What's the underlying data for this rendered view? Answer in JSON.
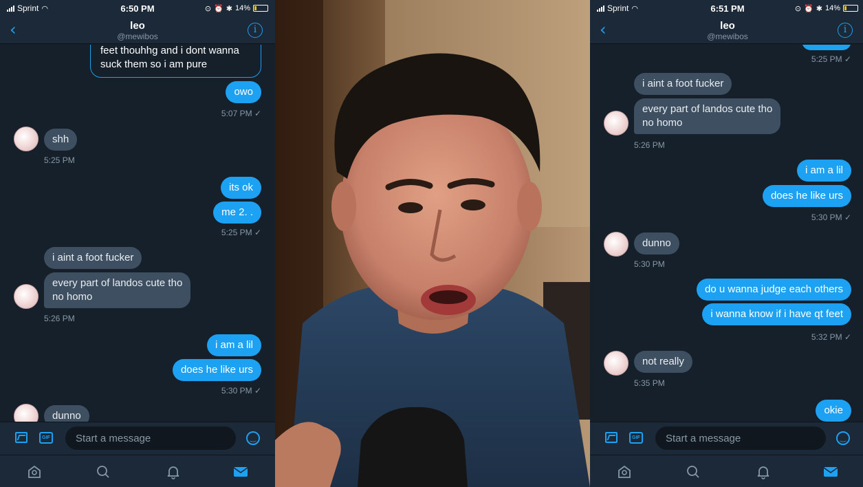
{
  "colors": {
    "accent": "#1da1f2",
    "background": "#15202b",
    "bar": "#1c2938",
    "incoming_bubble": "#3d4f61",
    "muted_text": "#8899a6",
    "battery_fill": "#f5c400"
  },
  "left": {
    "status": {
      "carrier": "Sprint",
      "time": "6:50 PM",
      "battery": "14%"
    },
    "header": {
      "name": "leo",
      "handle": "@mewibos"
    },
    "messages": {
      "quoted_line1": "feet thouhhg and i dont wanna",
      "quoted_line2": "suck them so i am pure",
      "owo": "owo",
      "ts_507": "5:07 PM ✓",
      "shh": "shh",
      "ts_525_in": "5:25 PM",
      "its_ok": "its ok",
      "me2": "me 2. .",
      "ts_525_out": "5:25 PM ✓",
      "foot": "i aint a foot fucker",
      "landos_line1": "every part of landos cute tho",
      "landos_line2": "no homo",
      "ts_526": "5:26 PM",
      "lil": "i am a lil",
      "urs": "does he like urs",
      "ts_530_out": "5:30 PM ✓",
      "dunno": "dunno"
    },
    "composer": {
      "placeholder": "Start a message",
      "gif_label": "GIF"
    }
  },
  "right": {
    "status": {
      "carrier": "Sprint",
      "time": "6:51 PM",
      "battery": "14%"
    },
    "header": {
      "name": "leo",
      "handle": "@mewibos"
    },
    "messages": {
      "ts_525_out": "5:25 PM ✓",
      "foot": "i aint a foot fucker",
      "landos_line1": "every part of landos cute tho",
      "landos_line2": "no homo",
      "ts_526": "5:26 PM",
      "lil": "i am a lil",
      "urs": "does he like urs",
      "ts_530_out": "5:30 PM ✓",
      "dunno": "dunno",
      "ts_530_in": "5:30 PM",
      "judge": "do u wanna judge each others",
      "qt": "i wanna know if i have qt feet",
      "ts_532": "5:32 PM ✓",
      "not_really": "not really",
      "ts_535": "5:35 PM",
      "okie": "okie"
    },
    "composer": {
      "placeholder": "Start a message",
      "gif_label": "GIF"
    }
  },
  "icons": {
    "back": "chevron-left-icon",
    "info": "info-icon",
    "media": "image-icon",
    "gif": "gif-icon",
    "emoji": "emoji-icon",
    "tabs": [
      "home-icon",
      "search-icon",
      "bell-icon",
      "mail-icon"
    ]
  },
  "battery_level": 0.14
}
